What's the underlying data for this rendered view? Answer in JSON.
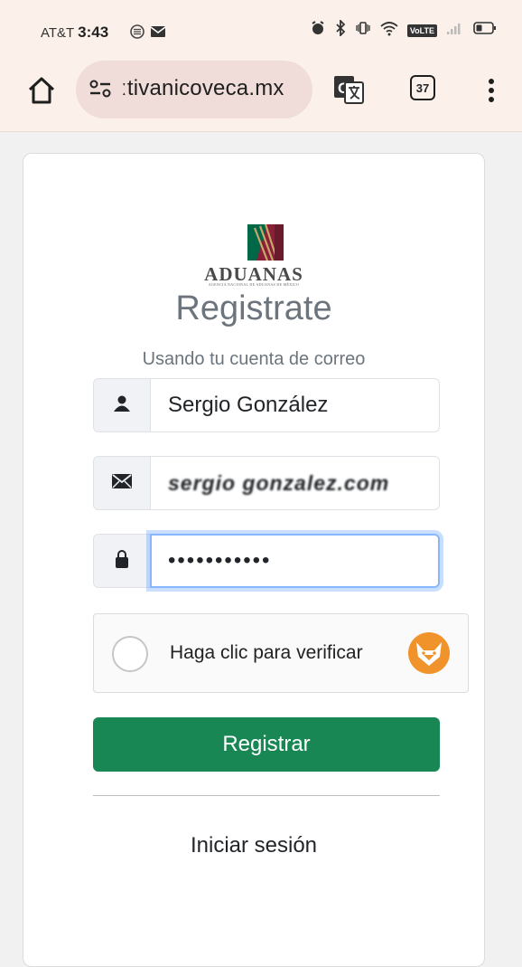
{
  "status_bar": {
    "carrier": "AT&T",
    "time": "3:43",
    "network_label": "VoLTE"
  },
  "browser": {
    "url": "ːtivanicoveca.mx",
    "tab_count": "37",
    "icons": [
      "home-icon",
      "site-settings-icon",
      "translate-icon",
      "tabs-icon",
      "more-vert-icon"
    ]
  },
  "card": {
    "logo_text": "ADUANAS",
    "logo_subtext": "AGENCIA NACIONAL DE ADUANAS DE MÉXICO",
    "title": "Registrate",
    "subtitle": "Usando tu cuenta de correo",
    "name_field": {
      "icon": "person-icon",
      "value": "Sergio González"
    },
    "email_field": {
      "icon": "envelope-icon",
      "value": "sergio gonzalez.com"
    },
    "password_field": {
      "icon": "lock-icon",
      "value": "•••••••••••"
    },
    "captcha": {
      "label": "Haga clic para verificar",
      "icon": "fox-icon"
    },
    "submit_label": "Registrar",
    "login_label": "Iniciar sesión"
  },
  "colors": {
    "browser_chrome": "#fbf1ea",
    "url_pill": "#f0dcd8",
    "primary_button": "#198754",
    "focus_ring": "#86b7fe",
    "captcha_fox": "#f0932b",
    "logo_green": "#006847",
    "logo_maroon": "#8a2036"
  }
}
